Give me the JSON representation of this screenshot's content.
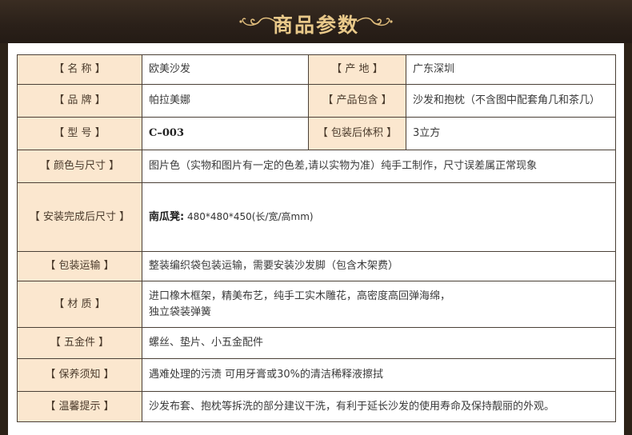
{
  "header": {
    "title": "商品参数"
  },
  "rows": {
    "r1": {
      "label_a": "【 名 称 】",
      "value_a": "欧美沙发",
      "label_b": "【 产 地 】",
      "value_b": "广东深圳"
    },
    "r2": {
      "label_a": "【 品 牌 】",
      "value_a": "帕拉美娜",
      "label_b": "【 产品包含 】",
      "value_b": "沙发和抱枕（不含图中配套角几和茶几）"
    },
    "r3": {
      "label_a": "【 型 号 】",
      "value_a": "C–003",
      "label_b": "【 包装后体积 】",
      "value_b": "3立方"
    },
    "r4": {
      "label": "【 颜色与尺寸 】",
      "value": "图片色（实物和图片有一定的色差,请以实物为准）纯手工制作，尺寸误差属正常现象"
    },
    "r5": {
      "label": "【 安装完成后尺寸 】",
      "dim_label": "南瓜凳:",
      "dim_value": " 480*480*450(长/宽/高mm)"
    },
    "r6": {
      "label": "【 包装运输 】",
      "value": "整装编织袋包装运输，需要安装沙发脚（包含木架费）"
    },
    "r7": {
      "label": "【 材 质 】",
      "line1": "进口橡木框架，精美布艺，纯手工实木雕花，高密度高回弹海绵，",
      "line2": "独立袋装弹簧"
    },
    "r8": {
      "label": "【 五金件 】",
      "value": "螺丝、垫片、小五金配件"
    },
    "r9": {
      "label": "【 保养须知 】",
      "value": "遇难处理的污渍 可用牙膏或30%的清洁稀释液擦拭"
    },
    "r10": {
      "label": "【 温馨提示 】",
      "value": "沙发布套、抱枕等拆洗的部分建议干洗，有利于延长沙发的使用寿命及保持靓丽的外观。"
    }
  },
  "colors": {
    "label_bg": "#fbe7cf",
    "banner_text": "#e9c98a",
    "border": "#4a4036"
  }
}
